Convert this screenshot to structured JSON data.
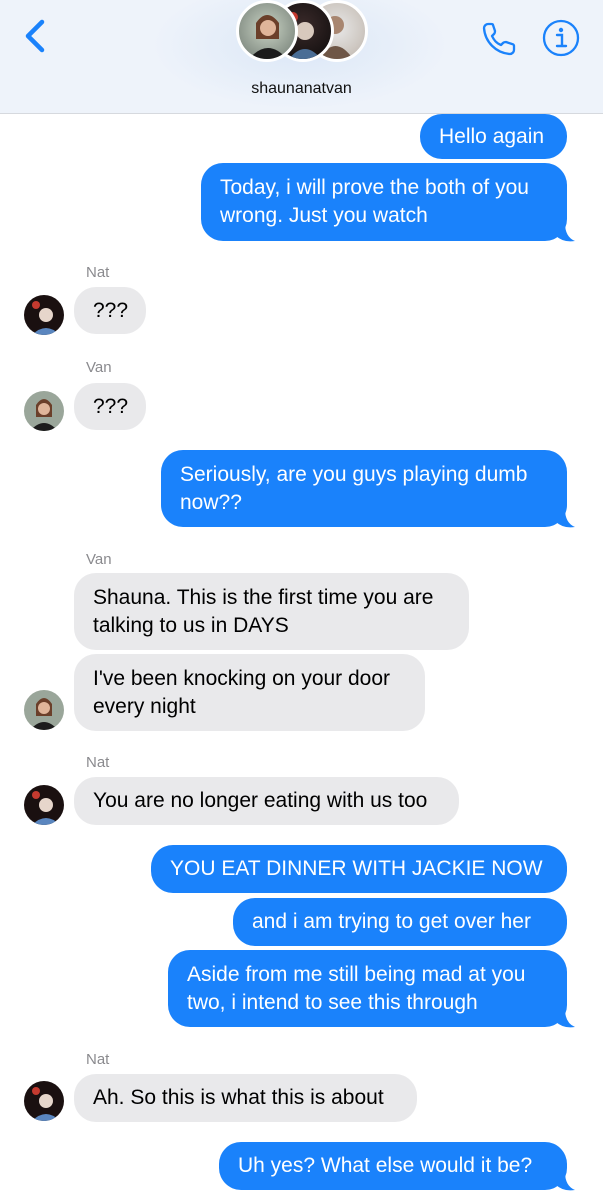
{
  "header": {
    "group_name": "shaunanatvan",
    "icons": [
      "back-chevron-icon",
      "phone-icon",
      "info-icon"
    ]
  },
  "colors": {
    "outgoing_bubble": "#1a82fb",
    "incoming_bubble": "#e9e9eb",
    "accent": "#1a82fb",
    "sender_label": "#8a8a8e"
  },
  "messages": [
    {
      "direction": "out",
      "text": "Hello again"
    },
    {
      "direction": "out",
      "text": "Today, i will prove the both of you\nwrong. Just you watch"
    },
    {
      "direction": "in",
      "sender": "Nat",
      "text": "???"
    },
    {
      "direction": "in",
      "sender": "Van",
      "text": "???"
    },
    {
      "direction": "out",
      "text": "Seriously, are you guys playing dumb\nnow??"
    },
    {
      "direction": "in",
      "sender": "Van",
      "text": "Shauna. This is the first time you are\ntalking to us in DAYS"
    },
    {
      "direction": "in",
      "text": "I've been knocking on your door\nevery night"
    },
    {
      "direction": "in",
      "sender": "Nat",
      "text": "You are no longer eating with us too"
    },
    {
      "direction": "out",
      "text": "YOU EAT DINNER WITH JACKIE NOW"
    },
    {
      "direction": "out",
      "text": "and i am trying to get over her"
    },
    {
      "direction": "out",
      "text": "Aside from me still being mad at you\ntwo, i intend to see this through"
    },
    {
      "direction": "in",
      "sender": "Nat",
      "text": "Ah. So this is what this is about"
    },
    {
      "direction": "out",
      "text": "Uh yes? What else would it be?"
    }
  ]
}
